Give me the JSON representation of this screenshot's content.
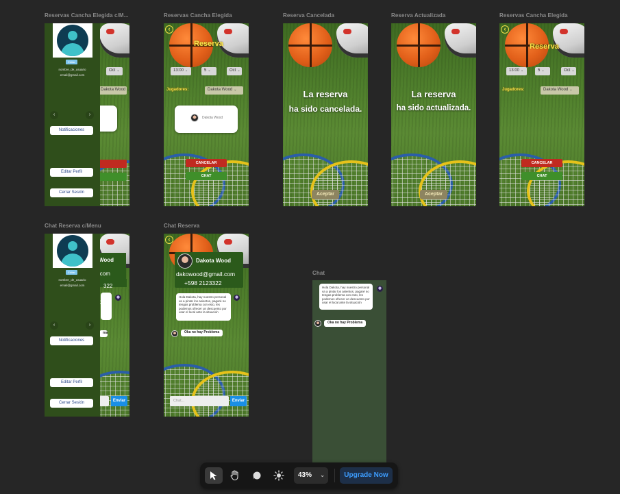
{
  "frames": {
    "f1": {
      "label": "Reservas Cancha Elegida c/M..."
    },
    "f2": {
      "label": "Reservas Cancha Elegida"
    },
    "f3": {
      "label": "Reserva Cancelada"
    },
    "f4": {
      "label": "Reserva Actualizada"
    },
    "f5": {
      "label": "Reservas Cancha Elegida"
    },
    "f6": {
      "label": "Chat Reserva c/Menu"
    },
    "f7": {
      "label": "Chat Reserva"
    },
    "f8": {
      "label": "Chat"
    }
  },
  "reserva": {
    "title": "Reserva",
    "time": "13:00",
    "people": "5",
    "month": "Oct",
    "players_label": "Jugadores:",
    "player_select": "Dakota Wood",
    "player_card": "Dakota Wood",
    "cancel": "CANCELAR",
    "chat": "CHAT"
  },
  "cancelled": {
    "line1": "La reserva",
    "line2": "ha sido cancelada.",
    "accept": "Aceptar"
  },
  "updated": {
    "line1": "La reserva",
    "line2": "ha sido actualizada.",
    "accept": "Aceptar"
  },
  "menu": {
    "edit_badge": "Editar",
    "username": "nombre_de_usuario",
    "email": "email@gmail.com",
    "notifications": "Notificaciones",
    "edit_profile": "Editar Perfil",
    "logout": "Cerrar Sesión"
  },
  "chat": {
    "contact_name": "Dakota Wood",
    "contact_email": "dakowood@gmail.com",
    "contact_phone": "+598 2123322",
    "contact_name_cut": "Wood",
    "contact_email_cut": "il.com",
    "contact_phone_cut": "322",
    "message_in": "Hola Dakota, hay nuestro personal va a pintar los asientos, pagaré no tengas problema con esto, les podemos ofrecer un descuento por usar el local ante la situación",
    "message_out": "Oka no hay Problema",
    "message_out_cut": "ma",
    "input_placeholder": "Chat...",
    "send": "Enviar"
  },
  "toolbar": {
    "zoom": "43%",
    "upgrade": "Upgrade Now"
  }
}
